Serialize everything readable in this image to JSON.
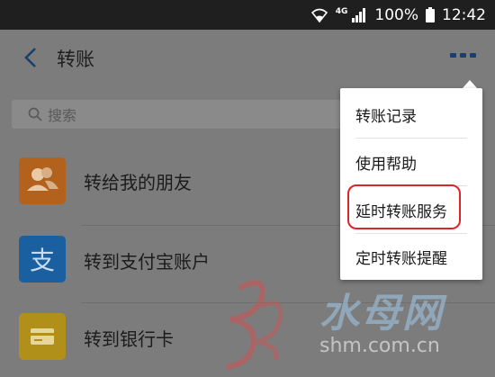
{
  "status_bar": {
    "network": "4G",
    "battery": "100%",
    "time": "12:42"
  },
  "header": {
    "title": "转账",
    "more_icon": "more-dots-icon",
    "back_icon": "chevron-left-icon"
  },
  "search": {
    "placeholder": "搜索",
    "icon": "search-icon"
  },
  "list": [
    {
      "label": "转给我的朋友",
      "icon": "friends-icon",
      "color": "#b3621d"
    },
    {
      "label": "转到支付宝账户",
      "icon": "alipay-icon",
      "color": "#1a5fa0"
    },
    {
      "label": "转到银行卡",
      "icon": "bank-card-icon",
      "color": "#b09018"
    }
  ],
  "menu": {
    "items": [
      "转账记录",
      "使用帮助",
      "延时转账服务",
      "定时转账提醒"
    ],
    "highlighted_index": 2,
    "highlight_color": "#d9242a"
  },
  "watermark": {
    "brand": "水母网",
    "url": "shm.com.cn"
  }
}
